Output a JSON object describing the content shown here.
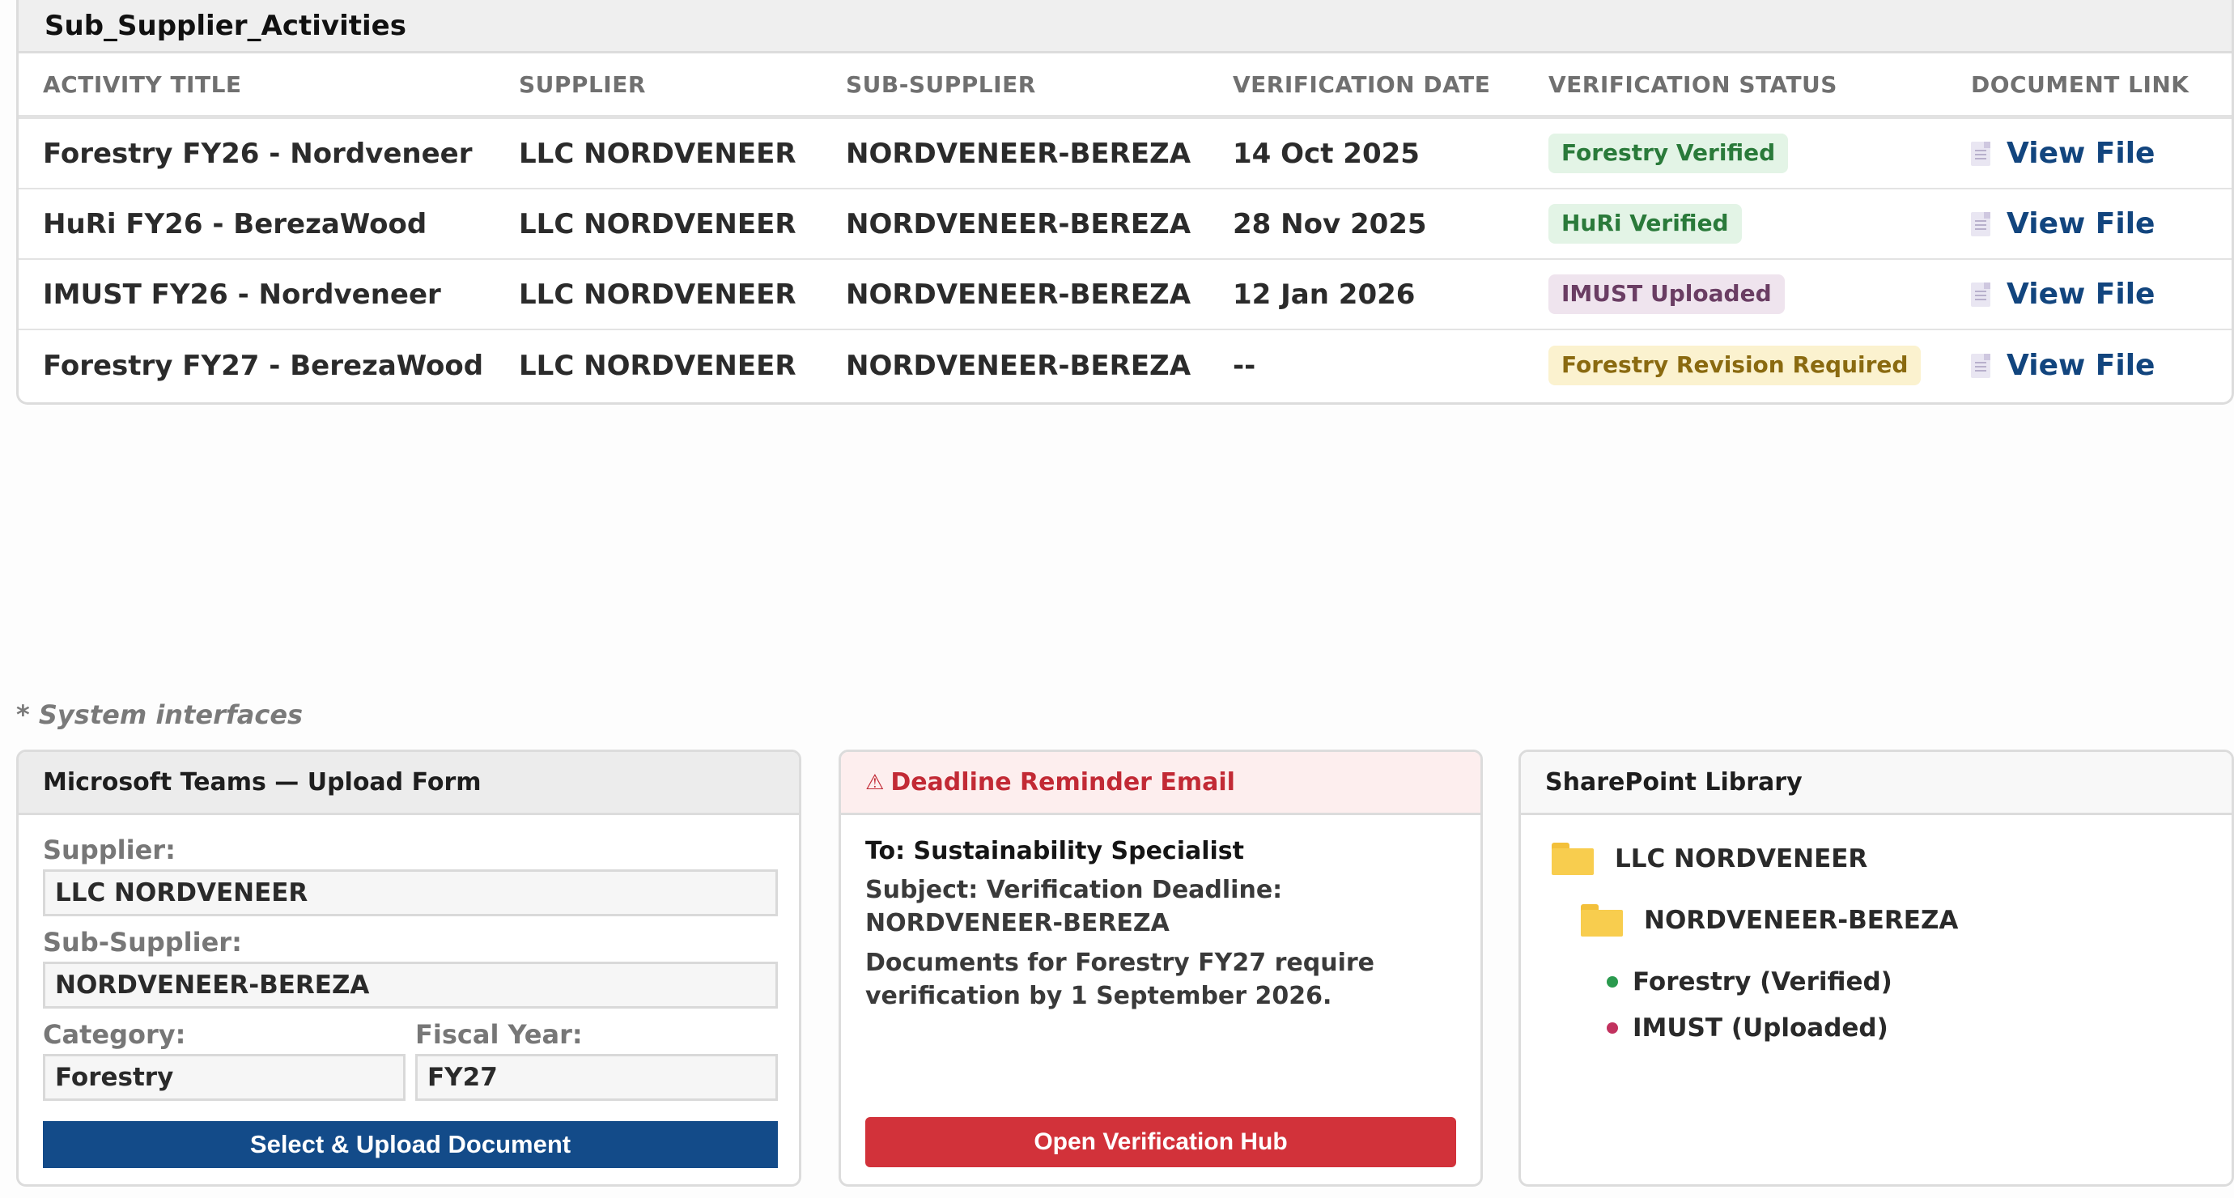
{
  "table": {
    "title": "Sub_Supplier_Activities",
    "headers": [
      "ACTIVITY TITLE",
      "SUPPLIER",
      "SUB-SUPPLIER",
      "VERIFICATION DATE",
      "VERIFICATION STATUS",
      "DOCUMENT LINK"
    ],
    "rows": [
      {
        "activity": "Forestry FY26 - Nordveneer",
        "supplier": "LLC NORDVENEER",
        "sub_supplier": "NORDVENEER-BEREZA",
        "date": "14 Oct 2025",
        "status": "Forestry Verified",
        "link": "View File"
      },
      {
        "activity": "HuRi FY26 - BerezaWood",
        "supplier": "LLC NORDVENEER",
        "sub_supplier": "NORDVENEER-BEREZA",
        "date": "28 Nov 2025",
        "status": "HuRi Verified",
        "link": "View File"
      },
      {
        "activity": "IMUST FY26 - Nordveneer",
        "supplier": "LLC NORDVENEER",
        "sub_supplier": "NORDVENEER-BEREZA",
        "date": "12 Jan 2026",
        "status": "IMUST Uploaded",
        "link": "View File"
      },
      {
        "activity": "Forestry FY27 - BerezaWood",
        "supplier": "LLC NORDVENEER",
        "sub_supplier": "NORDVENEER-BEREZA",
        "date": "--",
        "status": "Forestry Revision Required",
        "link": "View File"
      }
    ]
  },
  "caption": "* System interfaces",
  "teams_form": {
    "title": "Microsoft Teams — Upload Form",
    "supplier_label": "Supplier:",
    "supplier_value": "LLC NORDVENEER",
    "sub_supplier_label": "Sub-Supplier:",
    "sub_supplier_value": "NORDVENEER-BEREZA",
    "category_label": "Category:",
    "category_value": "Forestry",
    "fiscal_year_label": "Fiscal Year:",
    "fiscal_year_value": "FY27",
    "button_label": "Select & Upload Document"
  },
  "email": {
    "title": "Deadline Reminder Email",
    "icon": "warning-icon",
    "to": "To: Sustainability Specialist",
    "subject": "Subject: Verification Deadline: NORDVENEER-BEREZA",
    "body": "Documents for Forestry FY27 require verification by 1 September 2026.",
    "button_label": "Open Verification Hub"
  },
  "sharepoint": {
    "title": "SharePoint Library",
    "folder": "LLC NORDVENEER",
    "subfolder": "NORDVENEER-BEREZA",
    "files": [
      {
        "label": "Forestry (Verified)",
        "dot_color": "#2a9a4e"
      },
      {
        "label": "IMUST (Uploaded)",
        "dot_color": "#c2325f"
      }
    ]
  },
  "colors": {
    "link": "#12457e",
    "upload_button": "#134b89",
    "hub_button": "#d2323a",
    "verified_badge": "#e3f4e6",
    "uploaded_badge": "#efe4ee",
    "revision_badge": "#fbf2cf"
  }
}
